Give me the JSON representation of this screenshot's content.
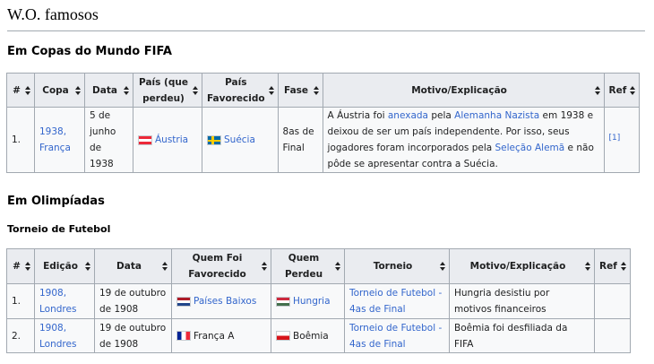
{
  "page": {
    "title": "W.O. famosos",
    "section_world_cup": "Em Copas do Mundo FIFA",
    "section_olympics": "Em Olimpíadas",
    "subsection_football": "Torneio de Futebol"
  },
  "world_cup_table": {
    "headers": [
      "#",
      "Copa",
      "Data",
      "País (que perdeu)",
      "País Favorecido",
      "Fase",
      "Motivo/Explicação",
      "Ref"
    ],
    "rows": [
      {
        "num": "1.",
        "copa": "1938, França",
        "data": "5 de junho de 1938",
        "loser": "Áustria",
        "loser_flag": "austria-flag-icon",
        "winner": "Suécia",
        "winner_flag": "sweden-flag-icon",
        "fase": "8as de Final",
        "motivo": {
          "t1": "A Áustria foi ",
          "l1": "anexada",
          "t2": " pela ",
          "l2": "Alemanha Nazista",
          "t3": " em 1938 e deixou de ser um país independente. Por isso, seus jogadores foram incorporados pela ",
          "l3": "Seleção Alemã",
          "t4": " e não pôde se apresentar contra a Suécia."
        },
        "ref": "[1]"
      }
    ]
  },
  "olympics_table": {
    "headers": [
      "#",
      "Edição",
      "Data",
      "Quem Foi Favorecido",
      "Quem Perdeu",
      "Torneio",
      "Motivo/Explicação",
      "Ref"
    ],
    "rows": [
      {
        "num": "1.",
        "edicao": "1908, Londres",
        "data": "19 de outubro de 1908",
        "favorecido": "Países Baixos",
        "favorecido_flag": "netherlands-flag-icon",
        "perdeu": "Hungria",
        "perdeu_flag": "hungary-flag-icon",
        "torneio": "Torneio de Futebol - 4as de Final",
        "motivo": "Hungria desistiu por motivos financeiros",
        "ref": ""
      },
      {
        "num": "2.",
        "edicao": "1908, Londres",
        "data": "19 de outubro de 1908",
        "favorecido": "França A",
        "favorecido_flag": "france-flag-icon",
        "perdeu": "Boêmia",
        "perdeu_flag": "bohemia-flag-icon",
        "torneio": "Torneio de Futebol - 4as de Final",
        "motivo": "Boêmia foi desfiliada da FIFA",
        "ref": ""
      }
    ]
  },
  "colors": {
    "link": "#3366cc",
    "header_bg": "#eaecf0",
    "cell_bg": "#f8f9fa",
    "border": "#a2a9b1"
  }
}
